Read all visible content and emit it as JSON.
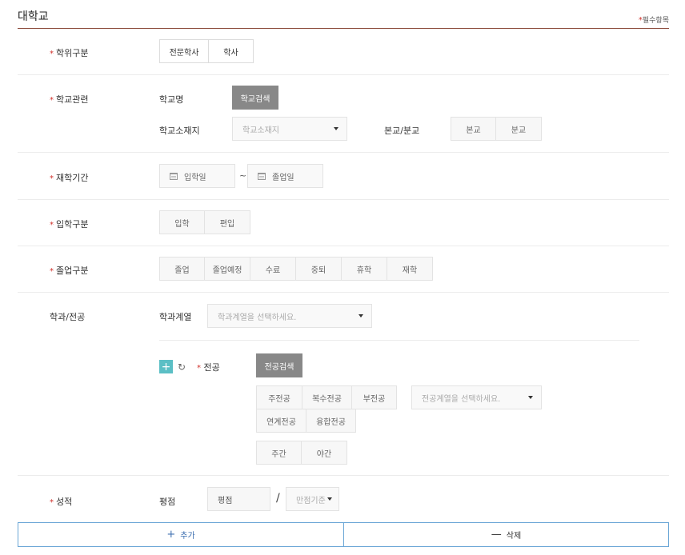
{
  "header": {
    "title": "대학교",
    "required_legend": "필수항목",
    "required_mark": "*"
  },
  "degree": {
    "label": "학위구분",
    "options": [
      "전문학사",
      "학사"
    ]
  },
  "school": {
    "label": "학교관련",
    "name_label": "학교명",
    "search_button": "학교검색",
    "location_label": "학교소재지",
    "location_placeholder": "학교소재지",
    "campus_label": "본교/분교",
    "campus_options": [
      "본교",
      "분교"
    ]
  },
  "period": {
    "label": "재학기간",
    "start_placeholder": "입학일",
    "tilde": "~",
    "end_placeholder": "졸업일"
  },
  "admission": {
    "label": "입학구분",
    "options": [
      "입학",
      "편입"
    ]
  },
  "graduation": {
    "label": "졸업구분",
    "options": [
      "졸업",
      "졸업예정",
      "수료",
      "중퇴",
      "휴학",
      "재학"
    ]
  },
  "major": {
    "label": "학과/전공",
    "field_label": "학과계열",
    "field_placeholder": "학과계열을 선택하세요.",
    "major_label": "전공",
    "add_icon": "+",
    "refresh_icon": "↻",
    "search_button": "전공검색",
    "type_options_row1": [
      "주전공",
      "복수전공",
      "부전공"
    ],
    "type_options_row2": [
      "연계전공",
      "융합전공"
    ],
    "type_select_placeholder": "전공계열을 선택하세요.",
    "time_options": [
      "주간",
      "야간"
    ]
  },
  "grade": {
    "label": "성적",
    "score_label": "평점",
    "score_placeholder": "평점",
    "slash": "/",
    "max_placeholder": "만점기준"
  },
  "actions": {
    "add_label": "추가",
    "add_icon": "+",
    "delete_label": "삭제",
    "delete_icon": "—"
  }
}
